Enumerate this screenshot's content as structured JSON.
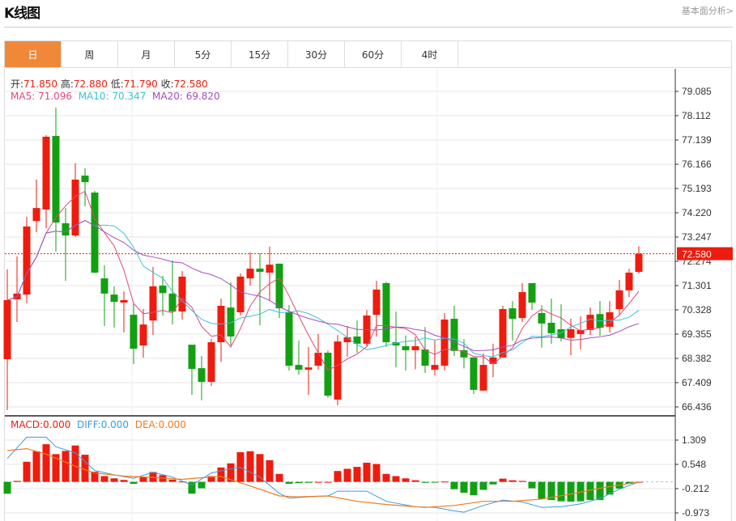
{
  "header": {
    "title": "K线图",
    "link": "基本面分析>"
  },
  "tabs": [
    {
      "label": "日",
      "active": true
    },
    {
      "label": "周"
    },
    {
      "label": "月"
    },
    {
      "label": "5分"
    },
    {
      "label": "15分"
    },
    {
      "label": "30分"
    },
    {
      "label": "60分"
    },
    {
      "label": "4时"
    }
  ],
  "ohlc_legend": {
    "open_label": "开:",
    "open": "71.850",
    "high_label": "高:",
    "high": "72.880",
    "low_label": "低:",
    "low": "71.790",
    "close_label": "收:",
    "close": "72.580"
  },
  "ma_legend": {
    "ma5": "MA5: 71.096",
    "ma10": "MA10: 70.347",
    "ma20": "MA20: 69.820"
  },
  "macd_legend": {
    "macd": "MACD:0.000",
    "diff": "DIFF:0.000",
    "dea": "DEA:0.000"
  },
  "colors": {
    "up": "#ee1c0e",
    "down": "#12a012",
    "ma5": "#e2477a",
    "ma10": "#3cc2d8",
    "ma20": "#a44cc0",
    "diff": "#3a9be0",
    "dea": "#f07b1f",
    "active_tab": "#f0883a"
  },
  "chart_data": [
    {
      "type": "candlestick",
      "title": "",
      "y_ticks": [
        "79.085",
        "78.112",
        "77.139",
        "76.166",
        "75.193",
        "74.220",
        "73.247",
        "72.274",
        "71.301",
        "70.328",
        "69.355",
        "68.382",
        "67.409",
        "66.436"
      ],
      "ylim": [
        66.436,
        79.085
      ],
      "last_price": "72.580",
      "grid": true,
      "ma_periods": [
        5,
        10,
        20
      ],
      "candles": [
        [
          68.35,
          71.95,
          66.31,
          70.72
        ],
        [
          70.75,
          72.47,
          69.84,
          70.98
        ],
        [
          70.94,
          74.06,
          70.59,
          73.67
        ],
        [
          73.89,
          75.55,
          73.44,
          74.41
        ],
        [
          74.35,
          77.33,
          73.6,
          77.27
        ],
        [
          77.3,
          78.44,
          72.66,
          73.83
        ],
        [
          73.8,
          74.41,
          71.49,
          73.31
        ],
        [
          73.31,
          76.2,
          73.25,
          75.55
        ],
        [
          75.71,
          76.0,
          74.48,
          75.45
        ],
        [
          75.03,
          75.1,
          71.8,
          71.82
        ],
        [
          71.59,
          72.11,
          69.68,
          70.98
        ],
        [
          70.94,
          71.27,
          69.62,
          70.65
        ],
        [
          70.62,
          71.07,
          69.42,
          70.72
        ],
        [
          70.13,
          70.59,
          68.15,
          68.77
        ],
        [
          68.9,
          70.36,
          68.41,
          69.74
        ],
        [
          69.9,
          72.05,
          69.32,
          71.27
        ],
        [
          71.3,
          71.69,
          70.1,
          71.0
        ],
        [
          70.98,
          72.31,
          69.74,
          70.26
        ],
        [
          70.26,
          71.88,
          69.94,
          71.66
        ],
        [
          68.93,
          68.93,
          66.92,
          67.96
        ],
        [
          67.99,
          68.48,
          66.7,
          67.44
        ],
        [
          67.44,
          69.16,
          67.28,
          69.03
        ],
        [
          69.03,
          70.78,
          68.25,
          70.49
        ],
        [
          70.42,
          71.43,
          68.9,
          69.26
        ],
        [
          70.23,
          71.79,
          70.1,
          71.66
        ],
        [
          71.59,
          72.63,
          71.3,
          71.98
        ],
        [
          71.98,
          72.6,
          69.71,
          71.85
        ],
        [
          71.82,
          72.86,
          70.68,
          72.14
        ],
        [
          72.18,
          72.18,
          70.0,
          70.39
        ],
        [
          70.23,
          70.52,
          67.89,
          68.09
        ],
        [
          68.12,
          69.1,
          67.73,
          67.93
        ],
        [
          67.93,
          68.84,
          66.92,
          68.02
        ],
        [
          68.09,
          69.36,
          67.93,
          68.61
        ],
        [
          68.61,
          68.7,
          66.8,
          66.89
        ],
        [
          66.73,
          69.32,
          66.5,
          69.06
        ],
        [
          69.03,
          69.68,
          68.45,
          69.23
        ],
        [
          69.26,
          69.9,
          68.6,
          68.97
        ],
        [
          68.97,
          70.32,
          68.85,
          70.1
        ],
        [
          70.13,
          71.49,
          69.26,
          71.14
        ],
        [
          71.4,
          71.45,
          68.85,
          69.03
        ],
        [
          69.03,
          70.26,
          68.02,
          68.9
        ],
        [
          68.87,
          69.3,
          67.9,
          68.71
        ],
        [
          68.71,
          69.25,
          67.95,
          68.87
        ],
        [
          68.74,
          69.64,
          67.8,
          68.09
        ],
        [
          67.93,
          69.1,
          67.7,
          68.12
        ],
        [
          68.09,
          70.2,
          67.9,
          69.94
        ],
        [
          69.97,
          70.49,
          68.48,
          68.68
        ],
        [
          68.71,
          69.15,
          67.98,
          68.42
        ],
        [
          68.42,
          68.42,
          66.95,
          67.12
        ],
        [
          67.09,
          68.58,
          67.09,
          68.12
        ],
        [
          68.16,
          68.97,
          67.63,
          68.42
        ],
        [
          68.42,
          70.49,
          68.42,
          70.36
        ],
        [
          70.39,
          70.68,
          69.1,
          69.97
        ],
        [
          70.0,
          71.4,
          69.84,
          71.04
        ],
        [
          71.4,
          71.4,
          70.33,
          70.62
        ],
        [
          70.2,
          70.52,
          68.81,
          69.78
        ],
        [
          69.81,
          70.78,
          68.97,
          69.39
        ],
        [
          69.55,
          70.55,
          69.06,
          69.2
        ],
        [
          69.2,
          69.97,
          68.51,
          69.55
        ],
        [
          69.36,
          70.07,
          68.74,
          69.52
        ],
        [
          69.52,
          70.42,
          69.32,
          70.13
        ],
        [
          70.16,
          70.68,
          69.29,
          69.61
        ],
        [
          69.65,
          70.68,
          69.42,
          70.23
        ],
        [
          70.36,
          71.53,
          70.1,
          71.11
        ],
        [
          71.11,
          71.98,
          70.85,
          71.82
        ],
        [
          71.85,
          72.88,
          71.79,
          72.58
        ]
      ]
    },
    {
      "type": "bar+line",
      "title": "",
      "y_ticks": [
        "1.309",
        "0.548",
        "-0.212",
        "-0.973"
      ],
      "ylim": [
        -0.973,
        1.309
      ],
      "macd": [
        -0.37,
        0.03,
        0.63,
        0.96,
        1.18,
        0.87,
        0.97,
        1.14,
        0.85,
        0.32,
        0.18,
        0.11,
        0.06,
        -0.06,
        0.15,
        0.31,
        0.21,
        0.07,
        0.01,
        -0.37,
        -0.2,
        0.18,
        0.45,
        0.58,
        0.93,
        0.96,
        0.87,
        0.68,
        0.25,
        -0.06,
        -0.04,
        -0.03,
        0.0,
        0.0,
        0.34,
        0.41,
        0.47,
        0.6,
        0.56,
        0.25,
        0.18,
        0.11,
        0.05,
        -0.03,
        -0.02,
        0.01,
        -0.23,
        -0.34,
        -0.42,
        -0.25,
        -0.08,
        0.1,
        0.05,
        0.03,
        -0.2,
        -0.53,
        -0.57,
        -0.61,
        -0.62,
        -0.61,
        -0.57,
        -0.57,
        -0.4,
        -0.21,
        -0.06,
        0.0
      ],
      "diff_points": [
        [
          1,
          0.73
        ],
        [
          3,
          1.4
        ],
        [
          5,
          1.4
        ],
        [
          6,
          1.1
        ],
        [
          8,
          0.91
        ],
        [
          10,
          0.36
        ],
        [
          12,
          0.22
        ],
        [
          14,
          0.11
        ],
        [
          16,
          0.3
        ],
        [
          18,
          0.15
        ],
        [
          20,
          -0.1
        ],
        [
          22,
          0.28
        ],
        [
          24,
          0.41
        ],
        [
          25,
          0.45
        ],
        [
          27,
          0.15
        ],
        [
          29,
          -0.36
        ],
        [
          30,
          -0.51
        ],
        [
          32,
          -0.47
        ],
        [
          34,
          -0.44
        ],
        [
          35,
          -0.29
        ],
        [
          38,
          -0.29
        ],
        [
          40,
          -0.61
        ],
        [
          43,
          -0.78
        ],
        [
          45,
          -0.8
        ],
        [
          47,
          -0.91
        ],
        [
          48,
          -0.95
        ],
        [
          50,
          -0.74
        ],
        [
          52,
          -0.57
        ],
        [
          54,
          -0.63
        ],
        [
          56,
          -0.8
        ],
        [
          58,
          -0.78
        ],
        [
          60,
          -0.69
        ],
        [
          62,
          -0.52
        ],
        [
          64,
          -0.23
        ],
        [
          66,
          0.0
        ]
      ],
      "dea_points": [
        [
          1,
          0.98
        ],
        [
          3,
          1.04
        ],
        [
          5,
          0.87
        ],
        [
          8,
          0.49
        ],
        [
          10,
          0.28
        ],
        [
          13,
          0.18
        ],
        [
          16,
          0.14
        ],
        [
          19,
          0.08
        ],
        [
          21,
          0.13
        ],
        [
          23,
          0.17
        ],
        [
          25,
          -0.03
        ],
        [
          27,
          -0.23
        ],
        [
          29,
          -0.44
        ],
        [
          31,
          -0.47
        ],
        [
          34,
          -0.44
        ],
        [
          37,
          -0.61
        ],
        [
          40,
          -0.71
        ],
        [
          44,
          -0.8
        ],
        [
          47,
          -0.74
        ],
        [
          50,
          -0.61
        ],
        [
          53,
          -0.61
        ],
        [
          56,
          -0.54
        ],
        [
          59,
          -0.38
        ],
        [
          62,
          -0.2
        ],
        [
          66,
          0.0
        ]
      ]
    }
  ]
}
